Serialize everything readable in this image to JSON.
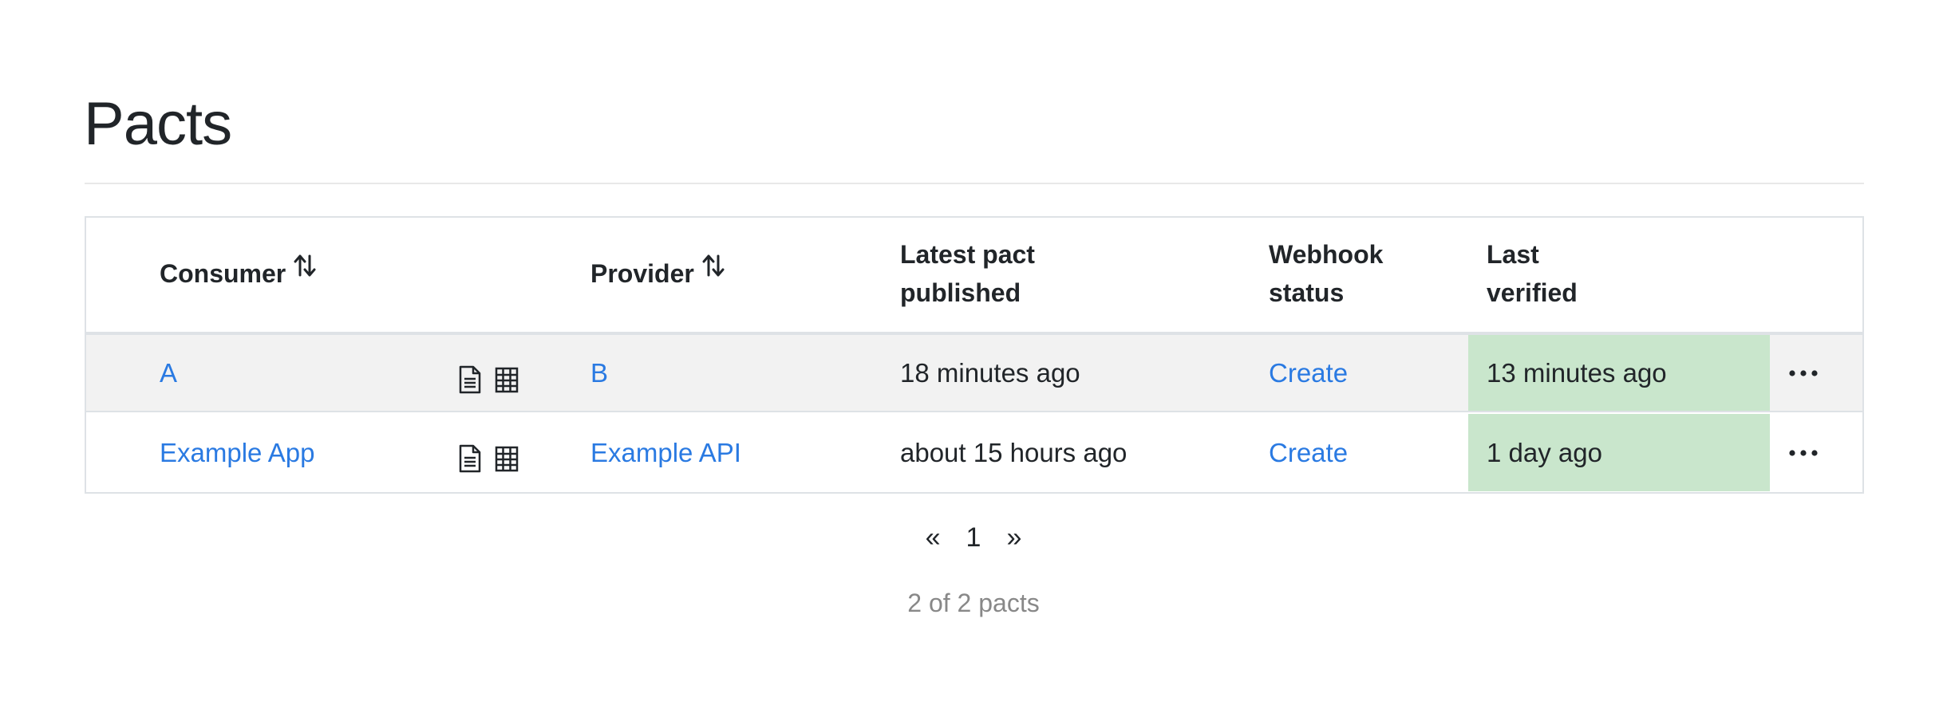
{
  "page": {
    "title": "Pacts"
  },
  "table": {
    "headers": {
      "consumer": "Consumer",
      "provider": "Provider",
      "latest_line1": "Latest pact",
      "latest_line2": "published",
      "webhook_line1": "Webhook",
      "webhook_line2": "status",
      "verified_line1": "Last",
      "verified_line2": "verified"
    },
    "rows": [
      {
        "consumer": "A",
        "provider": "B",
        "latest_pact_published": "18 minutes ago",
        "webhook_status": "Create",
        "last_verified": "13 minutes ago"
      },
      {
        "consumer": "Example App",
        "provider": "Example API",
        "latest_pact_published": "about 15 hours ago",
        "webhook_status": "Create",
        "last_verified": "1 day ago"
      }
    ]
  },
  "pagination": {
    "prev": "«",
    "current": "1",
    "next": "»",
    "count_text": "2 of 2 pacts"
  },
  "colors": {
    "link": "#2a7ae2",
    "verified_success": "#c9e6cc",
    "row_highlight": "#f2f2f2"
  },
  "icons": {
    "sort": "sort-arrows-icon",
    "document": "document-icon",
    "matrix": "table-grid-icon",
    "menu": "ellipsis-icon"
  }
}
